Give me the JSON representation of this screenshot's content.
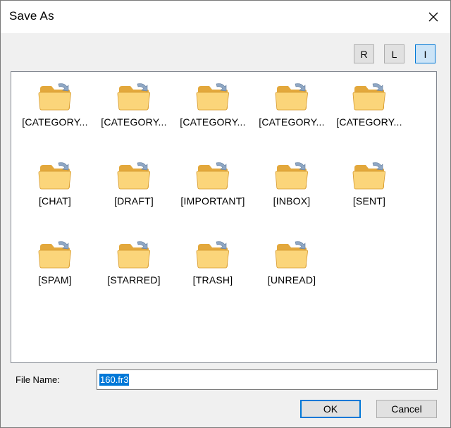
{
  "window": {
    "title": "Save As"
  },
  "view_buttons": [
    {
      "label": "R",
      "active": false
    },
    {
      "label": "L",
      "active": false
    },
    {
      "label": "I",
      "active": true
    }
  ],
  "folders": [
    {
      "label": "[CATEGORY..."
    },
    {
      "label": "[CATEGORY..."
    },
    {
      "label": "[CATEGORY..."
    },
    {
      "label": "[CATEGORY..."
    },
    {
      "label": "[CATEGORY..."
    },
    {
      "label": "[CHAT]"
    },
    {
      "label": "[DRAFT]"
    },
    {
      "label": "[IMPORTANT]"
    },
    {
      "label": "[INBOX]"
    },
    {
      "label": "[SENT]"
    },
    {
      "label": "[SPAM]"
    },
    {
      "label": "[STARRED]"
    },
    {
      "label": "[TRASH]"
    },
    {
      "label": "[UNREAD]"
    }
  ],
  "file_name": {
    "label": "File Name:",
    "value": "160.fr3"
  },
  "buttons": {
    "ok": "OK",
    "cancel": "Cancel"
  },
  "icons": {
    "close": "close-icon",
    "folder": "folder-icon"
  },
  "colors": {
    "accent": "#0078d7",
    "folder_body": "#fbd57a",
    "folder_shadow": "#e3a83c"
  }
}
